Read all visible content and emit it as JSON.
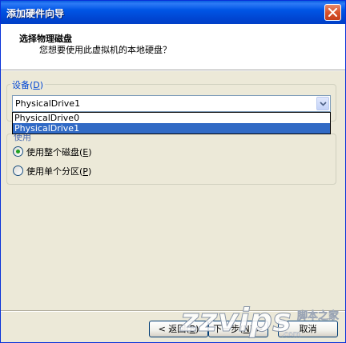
{
  "window": {
    "title": "添加硬件向导"
  },
  "header": {
    "title": "选择物理磁盘",
    "subtitle": "您想要使用此虚拟机的本地硬盘？"
  },
  "device": {
    "label": "设备",
    "accel": "D",
    "selected": "PhysicalDrive1",
    "options": [
      "PhysicalDrive0",
      "PhysicalDrive1"
    ],
    "highlighted_index": 1
  },
  "mode": {
    "label": "使用",
    "whole_disk": {
      "label": "使用整个磁盘",
      "accel": "E",
      "checked": true
    },
    "partition": {
      "label": "使用单个分区",
      "accel": "P",
      "checked": false
    }
  },
  "footer": {
    "back_label": "< 返回",
    "back_accel": "B",
    "next_label": "下一步",
    "next_accel": "N",
    "cancel_label": "取消"
  },
  "watermark": {
    "text": "zzvips",
    "suffix": ".com",
    "cn": "脚本之家"
  },
  "colors": {
    "title_bar": "#0055e5",
    "selection": "#316ac5",
    "radio_dot": "#21a121",
    "group_label": "#0046d5"
  }
}
